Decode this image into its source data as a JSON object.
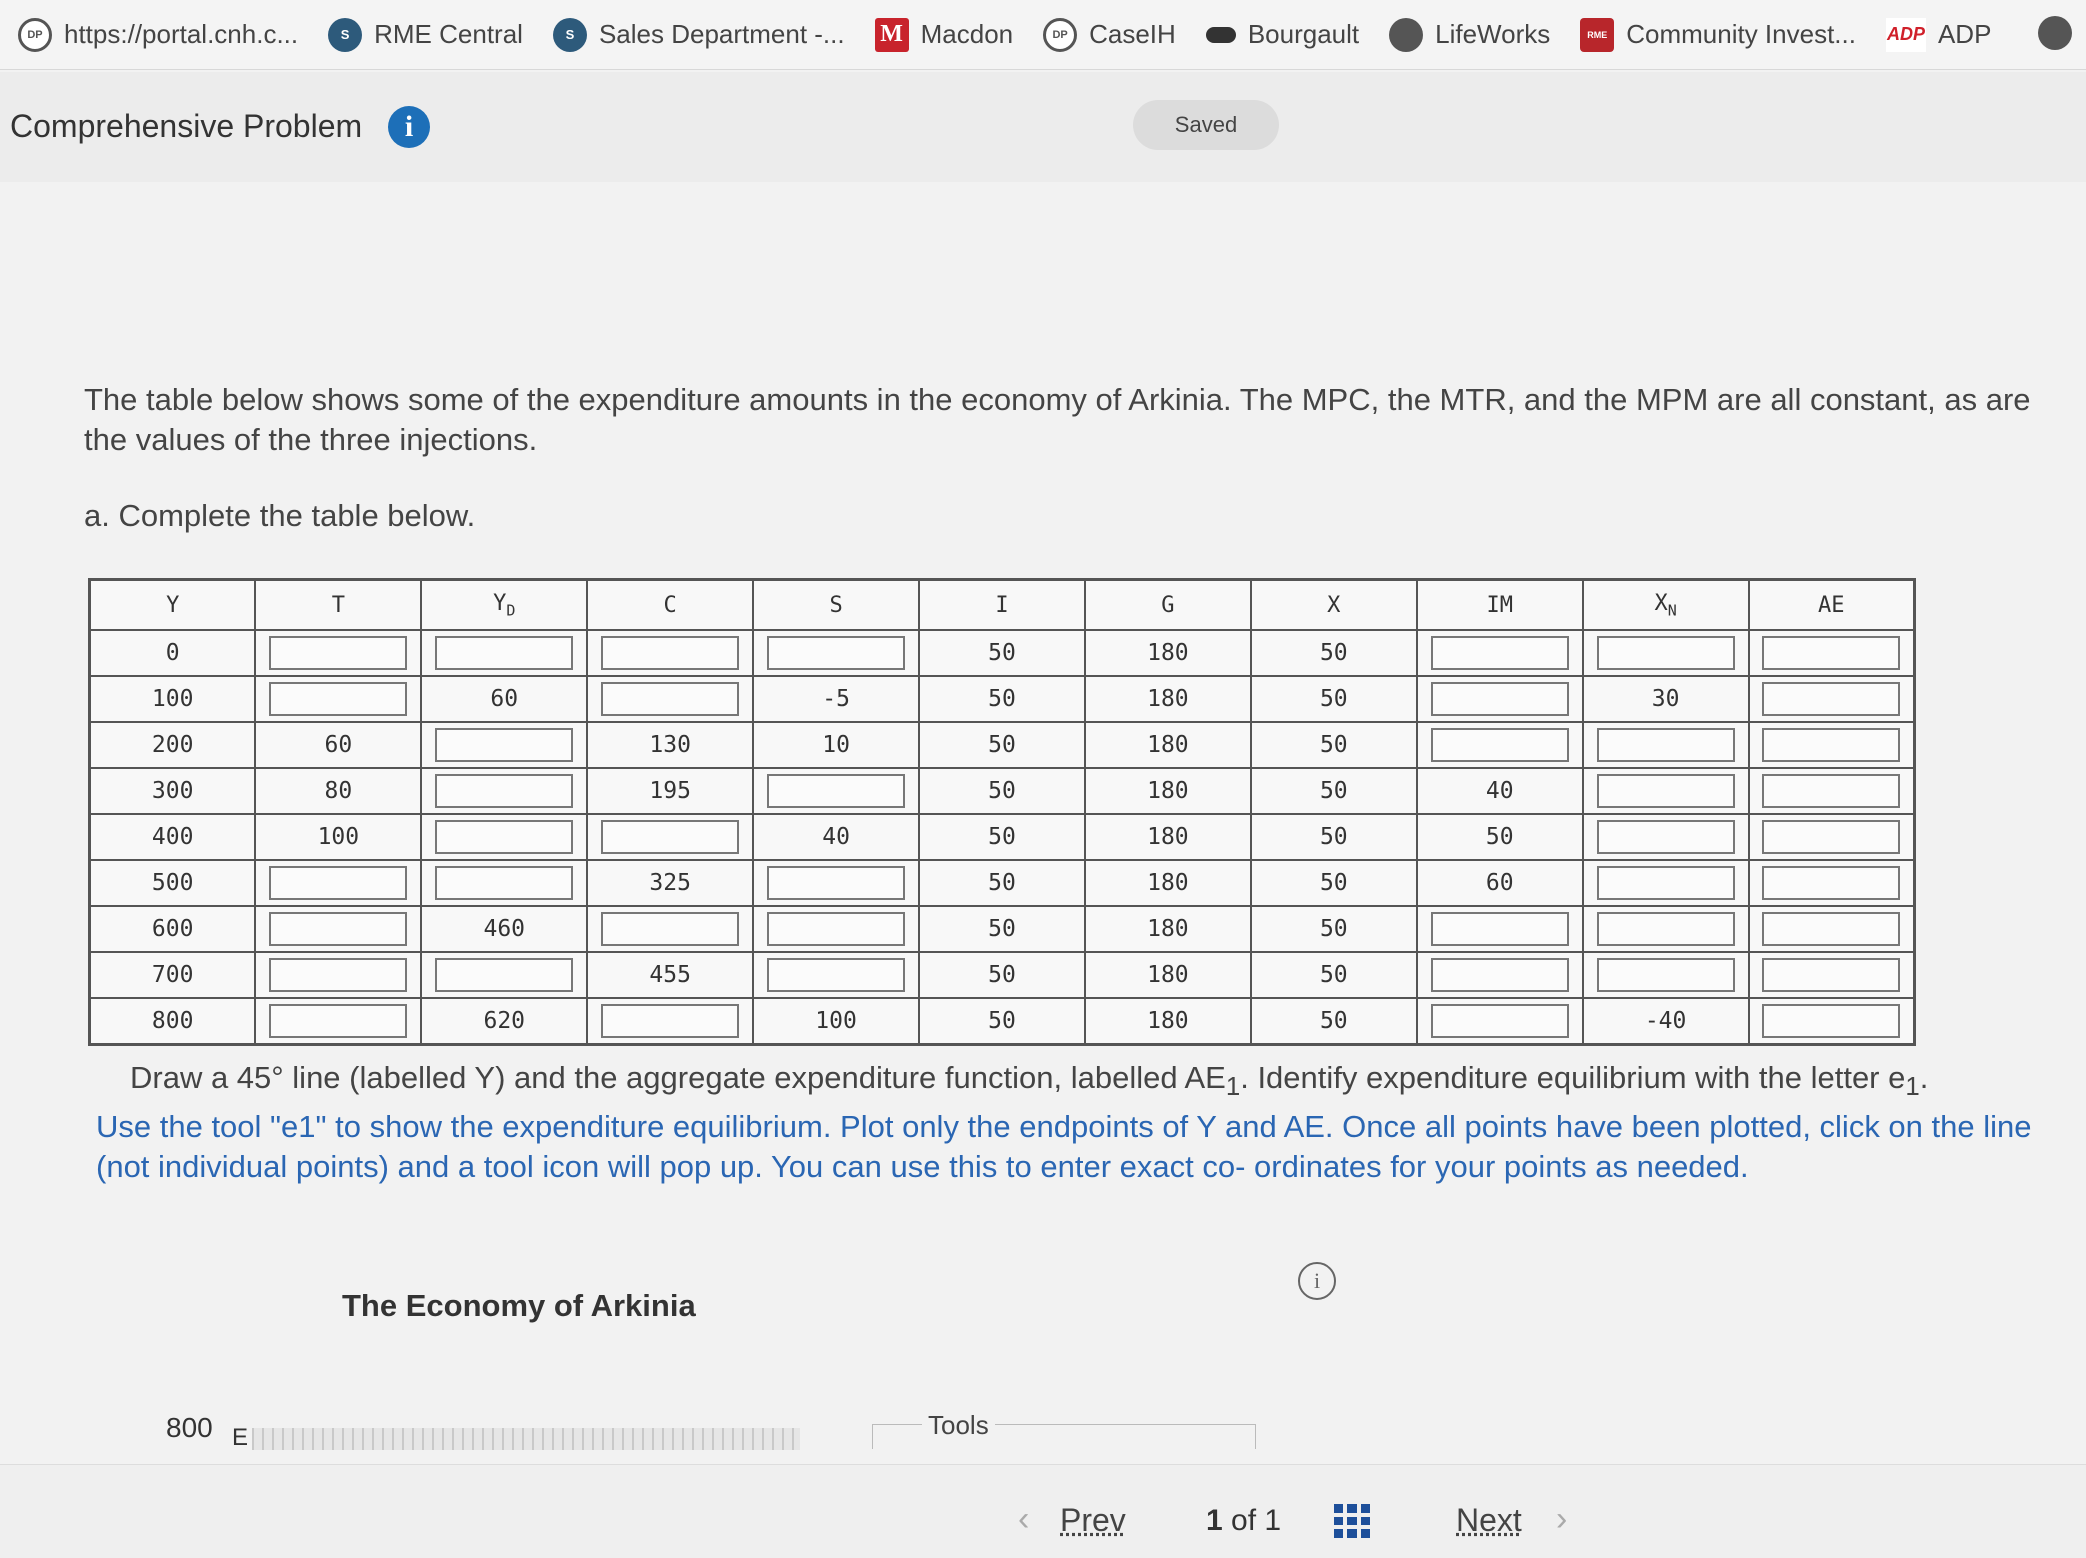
{
  "bookmarks": [
    {
      "icon": "dp-icon",
      "label": "https://portal.cnh.c..."
    },
    {
      "icon": "sharepoint-icon",
      "label": "RME Central"
    },
    {
      "icon": "sharepoint-icon",
      "label": "Sales Department -..."
    },
    {
      "icon": "macdon-m-icon",
      "label": "Macdon"
    },
    {
      "icon": "dp-icon",
      "label": "CaseIH"
    },
    {
      "icon": "bourgault-icon",
      "label": "Bourgault"
    },
    {
      "icon": "globe-icon",
      "label": "LifeWorks"
    },
    {
      "icon": "rme-icon",
      "label": "Community Invest..."
    },
    {
      "icon": "adp-icon",
      "label": "ADP"
    }
  ],
  "header": {
    "title": "Comprehensive Problem",
    "info_glyph": "i",
    "save_status": "Saved"
  },
  "question": {
    "intro": "The table below shows some of the expenditure amounts in the economy of Arkinia. The MPC, the MTR, and the MPM are all constant, as are the values of the three injections.",
    "part_a": "a. Complete the table below."
  },
  "table": {
    "headers": [
      "Y",
      "T",
      "YD",
      "C",
      "S",
      "I",
      "G",
      "X",
      "IM",
      "XN",
      "AE"
    ],
    "rows": [
      [
        "0",
        "",
        "",
        "",
        "",
        "50",
        "180",
        "50",
        "",
        "",
        ""
      ],
      [
        "100",
        "",
        "60",
        "",
        "-5",
        "50",
        "180",
        "50",
        "",
        "30",
        ""
      ],
      [
        "200",
        "60",
        "",
        "130",
        "10",
        "50",
        "180",
        "50",
        "",
        "",
        ""
      ],
      [
        "300",
        "80",
        "",
        "195",
        "",
        "50",
        "180",
        "50",
        "40",
        "",
        ""
      ],
      [
        "400",
        "100",
        "",
        "",
        "40",
        "50",
        "180",
        "50",
        "50",
        "",
        ""
      ],
      [
        "500",
        "",
        "",
        "325",
        "",
        "50",
        "180",
        "50",
        "60",
        "",
        ""
      ],
      [
        "600",
        "",
        "460",
        "",
        "",
        "50",
        "180",
        "50",
        "",
        "",
        ""
      ],
      [
        "700",
        "",
        "",
        "455",
        "",
        "50",
        "180",
        "50",
        "",
        "",
        ""
      ],
      [
        "800",
        "",
        "620",
        "",
        "100",
        "50",
        "180",
        "50",
        "",
        "-40",
        ""
      ]
    ]
  },
  "instructions": {
    "draw_prefix": "Draw a 45° line (labelled Y) and the aggregate expenditure function, labelled AE",
    "draw_sub1": "1",
    "draw_mid": ". Identify expenditure equilibrium with the letter e",
    "draw_sub2": "1",
    "draw_end": ".",
    "tool_help": "Use the tool \"e1\" to show the expenditure equilibrium. Plot only the endpoints of Y and AE. Once all points have been plotted, click on the line (not individual points) and a tool icon will pop up. You can use this to enter exact co- ordinates for your points as needed."
  },
  "graph": {
    "title": "The Economy of Arkinia",
    "info_glyph": "i",
    "y_top_tick": "800",
    "y_axis_letter": "E",
    "tools_label": "Tools"
  },
  "footer": {
    "prev": "Prev",
    "current_page": "1",
    "of_label": "of",
    "total_pages": "1",
    "next": "Next"
  }
}
